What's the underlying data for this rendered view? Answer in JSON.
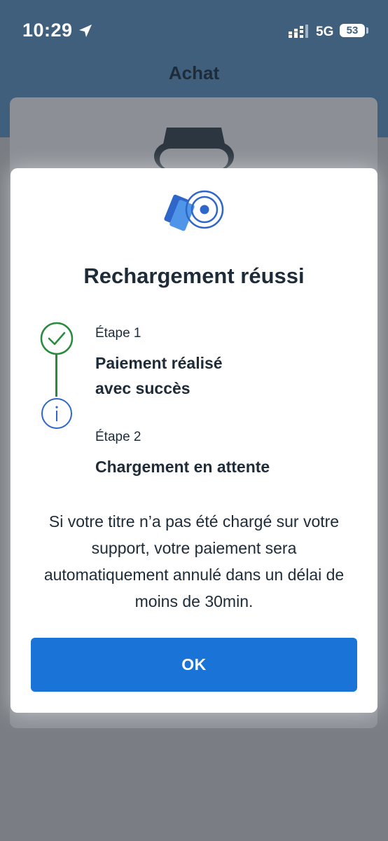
{
  "status_bar": {
    "time": "10:29",
    "network": "5G",
    "battery": "53"
  },
  "header": {
    "title": "Achat"
  },
  "modal": {
    "title": "Rechargement réussi",
    "steps": [
      {
        "label": "Étape 1",
        "line1": "Paiement réalisé",
        "line2": "avec succès",
        "status": "done"
      },
      {
        "label": "Étape 2",
        "text": "Chargement en attente",
        "status": "pending"
      }
    ],
    "message": "Si votre titre n’a pas été chargé sur votre support, votre paiement sera automatiquement annulé dans un délai de moins de 30min.",
    "ok_label": "OK"
  },
  "colors": {
    "header_bg": "#3f5f7d",
    "accent_blue": "#1a73d6",
    "success_green": "#2a8a3e",
    "text_dark": "#1e2b38"
  },
  "icons": {
    "location": "location-arrow-icon",
    "signal": "cellular-signal-icon",
    "watch": "smartwatch-icon",
    "contactless": "contactless-card-icon",
    "step_done": "check-circle-icon",
    "step_pending": "info-circle-icon"
  }
}
